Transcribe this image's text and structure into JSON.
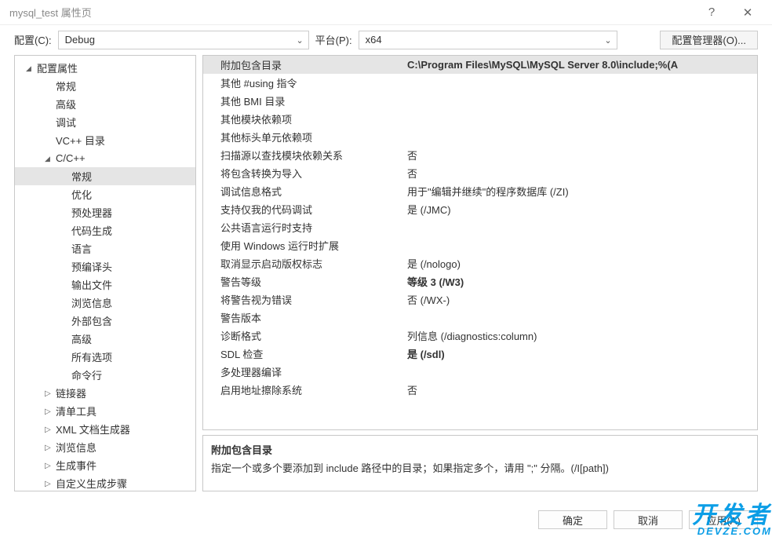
{
  "title": "mysql_test 属性页",
  "help_icon": "?",
  "close_icon": "✕",
  "toolbar": {
    "config_label": "配置(C):",
    "config_value": "Debug",
    "platform_label": "平台(P):",
    "platform_value": "x64",
    "manager_btn": "配置管理器(O)..."
  },
  "tree": [
    {
      "label": "配置属性",
      "level": 1,
      "arrow": "open"
    },
    {
      "label": "常规",
      "level": 2
    },
    {
      "label": "高级",
      "level": 2
    },
    {
      "label": "调试",
      "level": 2
    },
    {
      "label": "VC++ 目录",
      "level": 2
    },
    {
      "label": "C/C++",
      "level": 2,
      "arrow": "open"
    },
    {
      "label": "常规",
      "level": 3,
      "selected": true
    },
    {
      "label": "优化",
      "level": 3
    },
    {
      "label": "预处理器",
      "level": 3
    },
    {
      "label": "代码生成",
      "level": 3
    },
    {
      "label": "语言",
      "level": 3
    },
    {
      "label": "预编译头",
      "level": 3
    },
    {
      "label": "输出文件",
      "level": 3
    },
    {
      "label": "浏览信息",
      "level": 3
    },
    {
      "label": "外部包含",
      "level": 3
    },
    {
      "label": "高级",
      "level": 3
    },
    {
      "label": "所有选项",
      "level": 3
    },
    {
      "label": "命令行",
      "level": 3
    },
    {
      "label": "链接器",
      "level": 2,
      "arrow": "closed"
    },
    {
      "label": "清单工具",
      "level": 2,
      "arrow": "closed"
    },
    {
      "label": "XML 文档生成器",
      "level": 2,
      "arrow": "closed"
    },
    {
      "label": "浏览信息",
      "level": 2,
      "arrow": "closed"
    },
    {
      "label": "生成事件",
      "level": 2,
      "arrow": "closed"
    },
    {
      "label": "自定义生成步骤",
      "level": 2,
      "arrow": "closed"
    }
  ],
  "grid": [
    {
      "label": "附加包含目录",
      "value": "C:\\Program Files\\MySQL\\MySQL Server 8.0\\include;%(A",
      "selected": true,
      "bold_val": true
    },
    {
      "label": "其他 #using 指令",
      "value": ""
    },
    {
      "label": "其他 BMI 目录",
      "value": ""
    },
    {
      "label": "其他模块依赖项",
      "value": ""
    },
    {
      "label": "其他标头单元依赖项",
      "value": ""
    },
    {
      "label": "扫描源以查找模块依赖关系",
      "value": "否"
    },
    {
      "label": "将包含转换为导入",
      "value": "否"
    },
    {
      "label": "调试信息格式",
      "value": "用于\"编辑并继续\"的程序数据库 (/ZI)"
    },
    {
      "label": "支持仅我的代码调试",
      "value": "是 (/JMC)"
    },
    {
      "label": "公共语言运行时支持",
      "value": ""
    },
    {
      "label": "使用 Windows 运行时扩展",
      "value": ""
    },
    {
      "label": "取消显示启动版权标志",
      "value": "是 (/nologo)"
    },
    {
      "label": "警告等级",
      "value": "等级 3 (/W3)",
      "bold_val": true
    },
    {
      "label": "将警告视为错误",
      "value": "否 (/WX-)"
    },
    {
      "label": "警告版本",
      "value": ""
    },
    {
      "label": "诊断格式",
      "value": "列信息 (/diagnostics:column)"
    },
    {
      "label": "SDL 检查",
      "value": "是 (/sdl)",
      "bold_val": true
    },
    {
      "label": "多处理器编译",
      "value": ""
    },
    {
      "label": "启用地址擦除系统",
      "value": "否"
    }
  ],
  "desc": {
    "title": "附加包含目录",
    "text": "指定一个或多个要添加到 include 路径中的目录；如果指定多个，请用 \";\" 分隔。(/I[path])"
  },
  "footer": {
    "ok": "确定",
    "cancel": "取消",
    "apply": "应用(A)"
  },
  "watermark": {
    "main": "开发者",
    "sub": "DEVZE.COM"
  }
}
